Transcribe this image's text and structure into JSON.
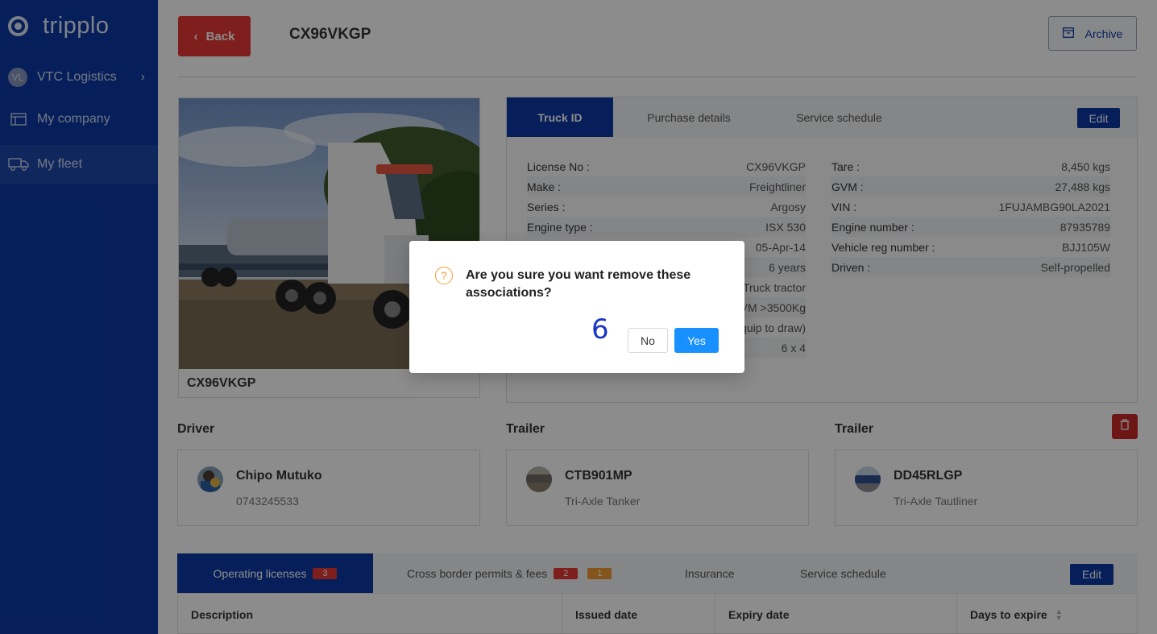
{
  "brand": {
    "name": "tripplo"
  },
  "sidebar": {
    "company": {
      "initials": "VL",
      "label": "VTC Logistics"
    },
    "items": [
      {
        "label": "My company"
      },
      {
        "label": "My fleet"
      }
    ]
  },
  "header": {
    "back_label": "Back",
    "title": "CX96VKGP",
    "archive_label": "Archive"
  },
  "photo": {
    "caption": "CX96VKGP"
  },
  "details": {
    "tabs": [
      "Truck ID",
      "Purchase details",
      "Service schedule"
    ],
    "edit_label": "Edit",
    "left": [
      {
        "label": "License No",
        "value": "CX96VKGP"
      },
      {
        "label": "Make",
        "value": "Freightliner"
      },
      {
        "label": "Series",
        "value": "Argosy"
      },
      {
        "label": "Engine type",
        "value": "ISX 530"
      },
      {
        "label": "",
        "value": "05-Apr-14"
      },
      {
        "label": "",
        "value": "6 years"
      },
      {
        "label": "",
        "value": "Truck tractor"
      },
      {
        "label": "",
        "value": "GVM >3500Kg"
      },
      {
        "label": "",
        "value": "quip to draw)"
      },
      {
        "label": "",
        "value": "6 x 4"
      }
    ],
    "right": [
      {
        "label": "Tare",
        "value": "8,450 kgs"
      },
      {
        "label": "GVM",
        "value": "27,488 kgs"
      },
      {
        "label": "VIN",
        "value": "1FUJAMBG90LA2021"
      },
      {
        "label": "Engine number",
        "value": "87935789"
      },
      {
        "label": "Vehicle reg number",
        "value": "BJJ105W"
      },
      {
        "label": "Driven",
        "value": "Self-propelled"
      }
    ]
  },
  "associations": {
    "driver": {
      "section": "Driver",
      "name": "Chipo Mutuko",
      "sub": "0743245533"
    },
    "trailer1": {
      "section": "Trailer",
      "name": "CTB901MP",
      "sub": "Tri-Axle Tanker"
    },
    "trailer2": {
      "section": "Trailer",
      "name": "DD45RLGP",
      "sub": "Tri-Axle Tautliner"
    }
  },
  "bottom": {
    "tabs": [
      {
        "label": "Operating licenses",
        "count": "3"
      },
      {
        "label": "Cross border permits & fees",
        "count": "2",
        "count2": "1"
      },
      {
        "label": "Insurance"
      },
      {
        "label": "Service schedule"
      }
    ],
    "edit_label": "Edit",
    "columns": [
      "Description",
      "Issued date",
      "Expiry date",
      "Days to expire"
    ]
  },
  "modal": {
    "message": "Are you sure you want remove these associations?",
    "annotation": "6",
    "no_label": "No",
    "yes_label": "Yes"
  },
  "colors": {
    "sidebar": "#0b3aa5",
    "primary": "#0b3aa5",
    "danger": "#e53935",
    "confirm": "#1890ff",
    "warning": "#f39c34"
  }
}
